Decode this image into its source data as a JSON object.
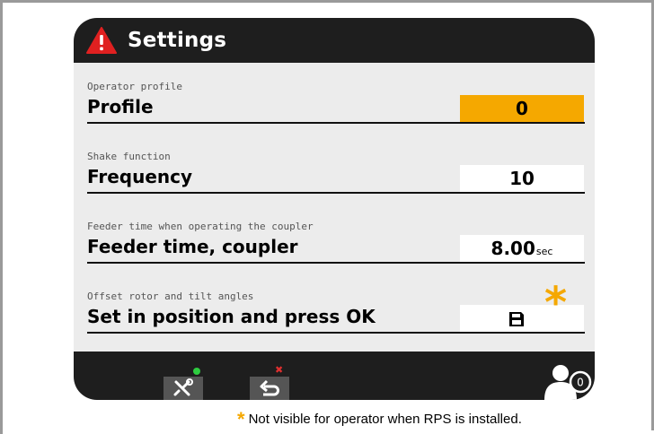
{
  "header": {
    "title": "Settings",
    "icon": "warning-icon"
  },
  "rows": [
    {
      "sublabel": "Operator profile",
      "label": "Profile",
      "value": "0",
      "unit": ""
    },
    {
      "sublabel": "Shake function",
      "label": "Frequency",
      "value": "10",
      "unit": ""
    },
    {
      "sublabel": "Feeder time when operating the coupler",
      "label": "Feeder time, coupler",
      "value": "8.00",
      "unit": "sec"
    },
    {
      "sublabel": "Offset rotor and tilt angles",
      "label": "Set in position and press OK",
      "icon": "save-icon"
    }
  ],
  "footer": {
    "tools_button": {
      "icon": "tools-icon",
      "indicator": "green-dot"
    },
    "back_button": {
      "icon": "back-arrow-icon",
      "indicator": "red-x"
    },
    "operator_icon": {
      "icon": "operator-profile-icon",
      "badge": "0"
    }
  },
  "annotation": {
    "marker": "*",
    "footnote": "Not visible for operator when RPS is installed."
  },
  "colors": {
    "accent": "#f5a800",
    "screen_bg": "#1e1e1e",
    "content_bg": "#ececec",
    "alert": "#e02020"
  }
}
